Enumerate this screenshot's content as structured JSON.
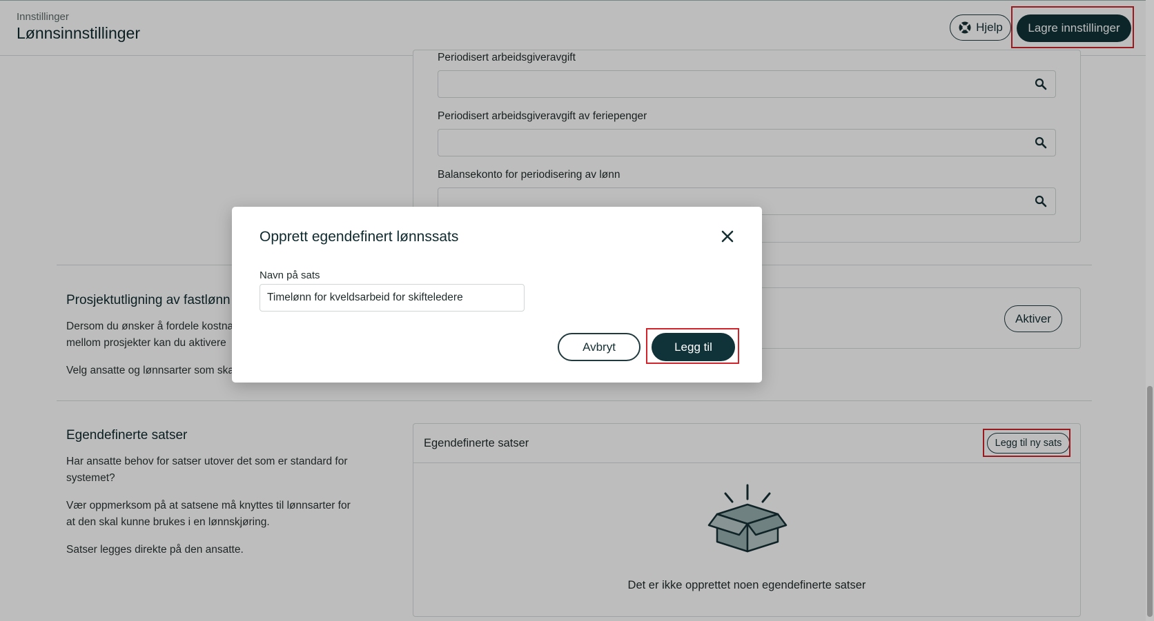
{
  "header": {
    "breadcrumb": "Innstillinger",
    "title": "Lønnsinnstillinger",
    "help_label": "Hjelp",
    "save_label": "Lagre innstillinger"
  },
  "accounts": {
    "fields": [
      {
        "label": "Periodisert arbeidsgiveravgift",
        "value": ""
      },
      {
        "label": "Periodisert arbeidsgiveravgift av feriepenger",
        "value": ""
      },
      {
        "label": "Balansekonto for periodisering av lønn",
        "value": ""
      }
    ]
  },
  "project_allocation": {
    "title": "Prosjektutligning av fastlønn",
    "para1": "Dersom du ønsker å fordele kostnader",
    "para1b": "mellom prosjekter kan du aktivere",
    "para2": "Velg ansatte og lønnsarter som skal",
    "activate_label": "Aktiver"
  },
  "custom_rates": {
    "title": "Egendefinerte satser",
    "para1a": "Har ansatte behov for satser utover det som er standard for",
    "para1b": "systemet?",
    "para2a": "Vær oppmerksom på at satsene må knyttes til lønnsarter for",
    "para2b": "at den skal kunne brukes i en lønnskjøring.",
    "para3": "Satser legges direkte på den ansatte.",
    "card_title": "Egendefinerte satser",
    "add_label": "Legg til ny sats",
    "empty_text": "Det er ikke opprettet noen egendefinerte satser"
  },
  "modal": {
    "title": "Opprett egendefinert lønnssats",
    "field_label": "Navn på sats",
    "field_value": "Timelønn for kveldsarbeid for skifteledere",
    "cancel_label": "Avbryt",
    "add_label": "Legg til"
  },
  "colors": {
    "primary": "#0f3338",
    "highlight": "#d0232a",
    "illustration": "#97aeae"
  },
  "icons": [
    "lifebuoy-icon",
    "search-icon",
    "close-icon",
    "empty-box-icon"
  ]
}
